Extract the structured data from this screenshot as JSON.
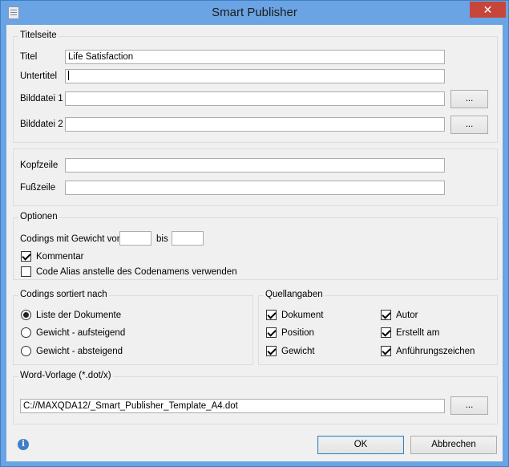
{
  "window": {
    "title": "Smart Publisher",
    "close_glyph": "✕"
  },
  "titelseite": {
    "group_title": "Titelseite",
    "titel_label": "Titel",
    "titel_value": "Life Satisfaction",
    "untertitel_label": "Untertitel",
    "untertitel_value": "",
    "bilddatei1_label": "Bilddatei 1",
    "bilddatei1_value": "",
    "bilddatei2_label": "Bilddatei 2",
    "bilddatei2_value": "",
    "browse_label": "..."
  },
  "kopf": {
    "kopfzeile_label": "Kopfzeile",
    "kopfzeile_value": "",
    "fusszeile_label": "Fußzeile",
    "fusszeile_value": ""
  },
  "optionen": {
    "group_title": "Optionen",
    "gewicht_von_label": "Codings mit Gewicht von",
    "gewicht_von_value": "",
    "bis_label": "bis",
    "bis_value": "",
    "kommentar_label": "Kommentar",
    "kommentar_checked": true,
    "code_alias_label": "Code Alias anstelle des Codenamens verwenden",
    "code_alias_checked": false
  },
  "sortierung": {
    "group_title": "Codings sortiert nach",
    "options": [
      "Liste der Dokumente",
      "Gewicht - aufsteigend",
      "Gewicht - absteigend"
    ],
    "selected_index": 0
  },
  "quellangaben": {
    "group_title": "Quellangaben",
    "items": [
      {
        "label": "Dokument",
        "checked": true
      },
      {
        "label": "Autor",
        "checked": true
      },
      {
        "label": "Position",
        "checked": true
      },
      {
        "label": "Erstellt am",
        "checked": true
      },
      {
        "label": "Gewicht",
        "checked": true
      },
      {
        "label": "Anführungszeichen",
        "checked": true
      }
    ]
  },
  "vorlage": {
    "group_title": "Word-Vorlage (*.dot/x)",
    "path_value": "C://MAXQDA12/_Smart_Publisher_Template_A4.dot",
    "browse_label": "..."
  },
  "footer": {
    "info_glyph": "i",
    "ok_label": "OK",
    "cancel_label": "Abbrechen"
  }
}
